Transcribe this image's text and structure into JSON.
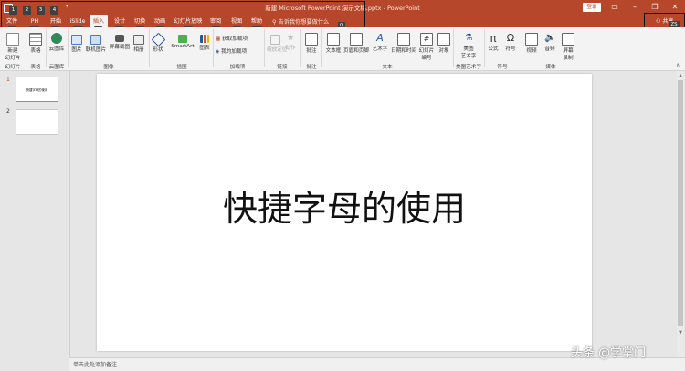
{
  "title_bar": {
    "title": "新建 Microsoft PowerPoint 演示文稿.pptx  -  PowerPoint",
    "login": "登录",
    "qat_keytips": [
      "1",
      "2",
      "3",
      "4"
    ]
  },
  "tabs": [
    {
      "label": "文件",
      "keytip": "F"
    },
    {
      "label": "PH",
      "keytip": "Y1"
    },
    {
      "label": "开始",
      "keytip": "H"
    },
    {
      "label": "iSlide",
      "keytip": "Y2"
    },
    {
      "label": "插入",
      "keytip": "N"
    },
    {
      "label": "设计",
      "keytip": "G"
    },
    {
      "label": "切换",
      "keytip": "K"
    },
    {
      "label": "动画",
      "keytip": "A"
    },
    {
      "label": "幻灯片放映",
      "keytip": "S"
    },
    {
      "label": "审阅",
      "keytip": "R"
    },
    {
      "label": "视图",
      "keytip": "W"
    },
    {
      "label": "帮助",
      "keytip": "Y3"
    }
  ],
  "tell_me": {
    "text": "告诉我你想要做什么",
    "keytip": "Q"
  },
  "share": {
    "label": "共享",
    "keytip": "ZS"
  },
  "ribbon": {
    "buttons": [
      {
        "label": "新建\n幻灯片",
        "group": "slides"
      },
      {
        "label": "表格",
        "group": "tables"
      },
      {
        "label": "云图库",
        "group": "cloud"
      },
      {
        "label": "图片",
        "group": "images"
      },
      {
        "label": "联机图片",
        "group": "images"
      },
      {
        "label": "屏幕截图",
        "group": "images"
      },
      {
        "label": "相册",
        "group": "images"
      },
      {
        "label": "形状",
        "group": "illustrations"
      },
      {
        "label": "SmartArt",
        "group": "illustrations"
      },
      {
        "label": "图表",
        "group": "illustrations"
      },
      {
        "label": "获取加载项",
        "group": "addins"
      },
      {
        "label": "我的加载项",
        "group": "addins"
      },
      {
        "label": "缩放定位",
        "group": "links"
      },
      {
        "label": "动作",
        "group": "links"
      },
      {
        "label": "批注",
        "group": "comments"
      },
      {
        "label": "文本框",
        "group": "text"
      },
      {
        "label": "页眉和页脚",
        "group": "text"
      },
      {
        "label": "艺术字",
        "group": "text"
      },
      {
        "label": "日期和时间",
        "group": "text"
      },
      {
        "label": "幻灯片\n编号",
        "group": "text"
      },
      {
        "label": "对象",
        "group": "text"
      },
      {
        "label": "美图\n艺术字",
        "group": "meitu"
      },
      {
        "label": "公式",
        "group": "symbols"
      },
      {
        "label": "符号",
        "group": "symbols"
      },
      {
        "label": "视频",
        "group": "media"
      },
      {
        "label": "音频",
        "group": "media"
      },
      {
        "label": "屏幕\n录制",
        "group": "media"
      }
    ],
    "group_labels": {
      "slides": "幻灯片",
      "tables": "表格",
      "cloud": "云图库",
      "images": "图像",
      "illustrations": "插图",
      "addins": "加载项",
      "links": "链接",
      "comments": "批注",
      "text": "文本",
      "meitu": "美图艺术字",
      "symbols": "符号",
      "media": "媒体"
    }
  },
  "slides_pane": {
    "slides": [
      {
        "number": "1",
        "thumb_text": "快捷字母的使用",
        "selected": true
      },
      {
        "number": "2",
        "thumb_text": "",
        "selected": false
      }
    ]
  },
  "slide": {
    "text": "快捷字母的使用"
  },
  "notes": {
    "placeholder": "单击此处添加备注"
  },
  "watermark": "头条 @学掌门",
  "colors": {
    "accent": "#b7472a",
    "ribbon_bg": "#f3f3f3",
    "app_bg": "#e6e6e6"
  }
}
